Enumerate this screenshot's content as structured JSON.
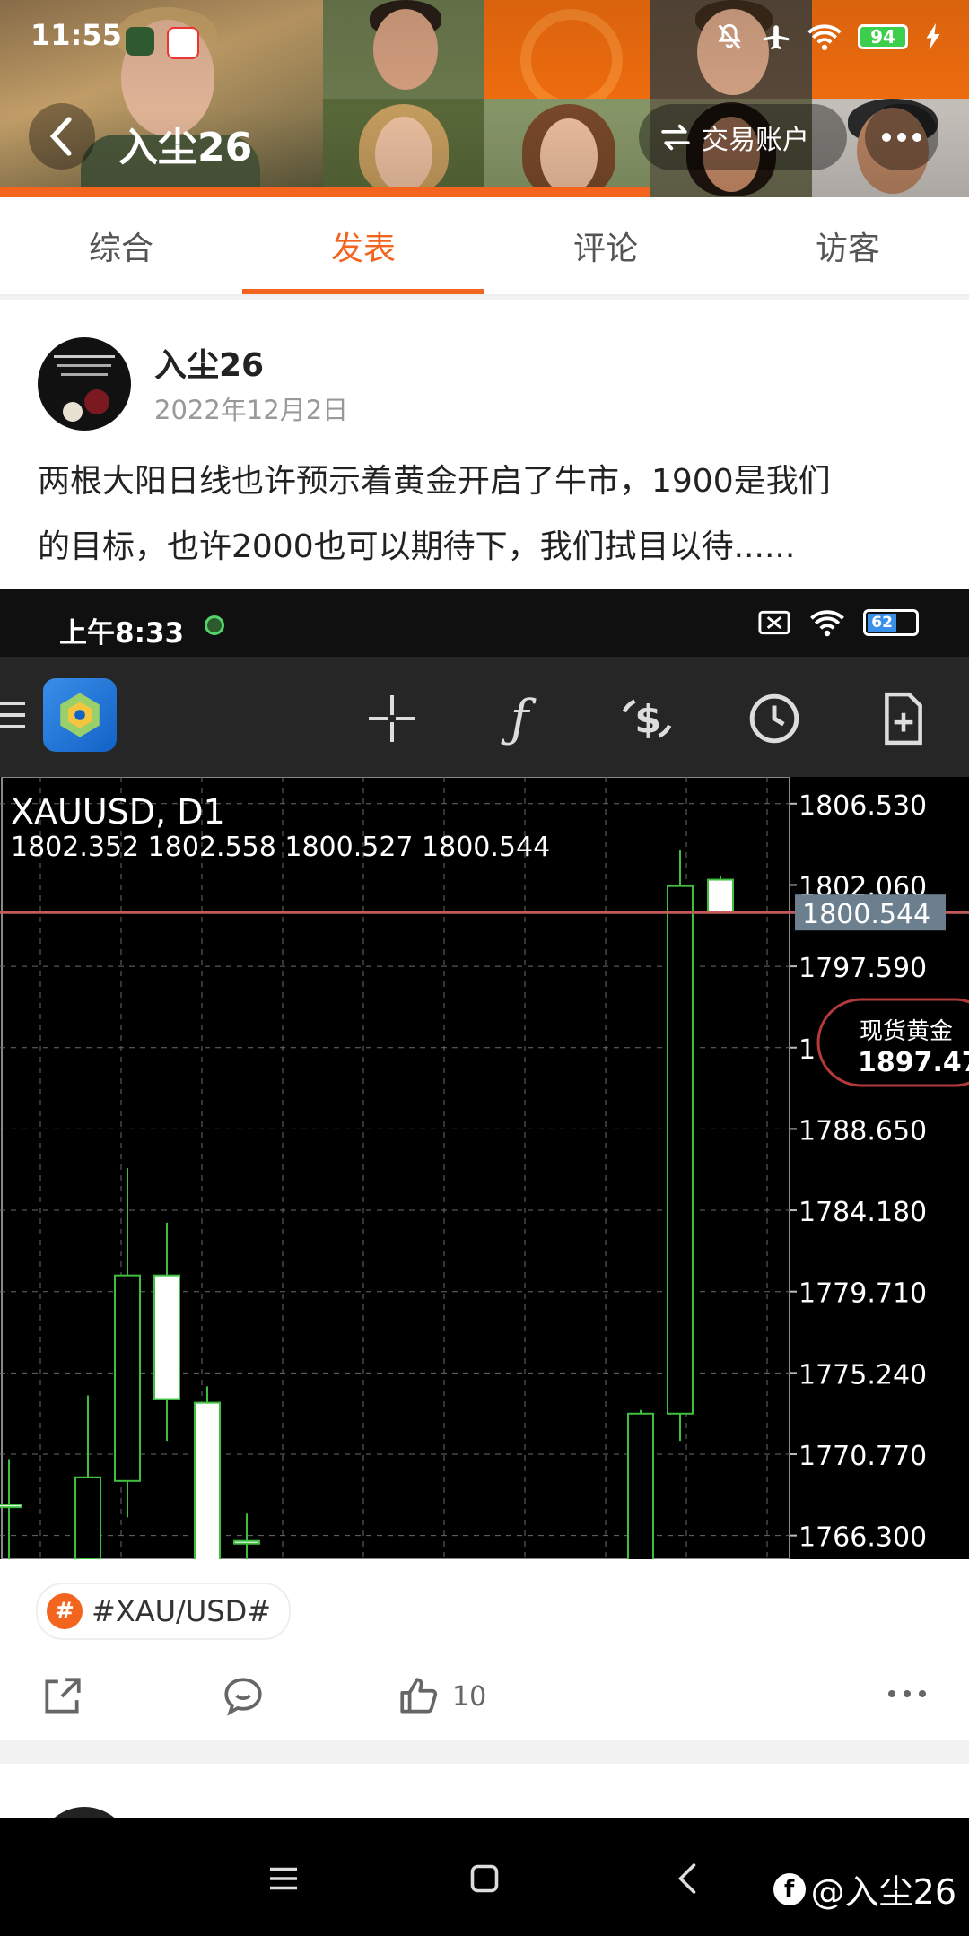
{
  "status_bar": {
    "time": "11:55",
    "battery": "94"
  },
  "header": {
    "title": "入尘26",
    "account_button": "交易账户"
  },
  "tabs": [
    {
      "label": "综合",
      "active": false
    },
    {
      "label": "发表",
      "active": true
    },
    {
      "label": "评论",
      "active": false
    },
    {
      "label": "访客",
      "active": false
    }
  ],
  "post": {
    "author": "入尘26",
    "date": "2022年12月2日",
    "text_line1": "两根大阳日线也许预示着黄金开启了牛市，1900是我们",
    "text_line2": "的目标，也许2000也可以期待下，我们拭目以待......",
    "tag": "#XAU/USD#",
    "like_count": "10"
  },
  "embedded_screenshot": {
    "status_time": "上午8:33",
    "battery": "62",
    "chart_data": {
      "type": "candlestick",
      "symbol": "XAUUSD, D1",
      "ohlc_label": "1802.352 1802.558 1800.527 1800.544",
      "current_price_label": "1800.544",
      "current_price": 1800.544,
      "y_ticks": [
        "1806.530",
        "1802.060",
        "1797.590",
        "1793.120",
        "1788.650",
        "1784.180",
        "1779.710",
        "1775.240",
        "1770.770",
        "1766.300"
      ],
      "ylim": [
        1765,
        1808
      ],
      "grid": true,
      "candles": [
        {
          "open": 1768,
          "close": 1768,
          "high": 1770.5,
          "low": 1764,
          "bull": false
        },
        {
          "open": 1765,
          "close": 1769.5,
          "high": 1774,
          "low": 1764,
          "bull": true
        },
        {
          "open": 1769.3,
          "close": 1780.6,
          "high": 1786.5,
          "low": 1767.3,
          "bull": true
        },
        {
          "open": 1780.6,
          "close": 1773.8,
          "high": 1783.5,
          "low": 1771.5,
          "bull": false
        },
        {
          "open": 1773.6,
          "close": 1764,
          "high": 1774.5,
          "low": 1764,
          "bull": false
        },
        {
          "open": 1766,
          "close": 1766,
          "high": 1767.5,
          "low": 1764,
          "bull": false
        },
        {
          "open": 1764,
          "close": 1773,
          "high": 1773.2,
          "low": 1764,
          "bull": true
        },
        {
          "open": 1773,
          "close": 1802,
          "high": 1804,
          "low": 1771.5,
          "bull": true
        },
        {
          "open": 1802.352,
          "close": 1800.544,
          "high": 1802.558,
          "low": 1800.527,
          "bull": false
        }
      ]
    },
    "badge": {
      "label": "现货黄金",
      "value": "1897.47"
    }
  },
  "watermark": "@入尘26"
}
